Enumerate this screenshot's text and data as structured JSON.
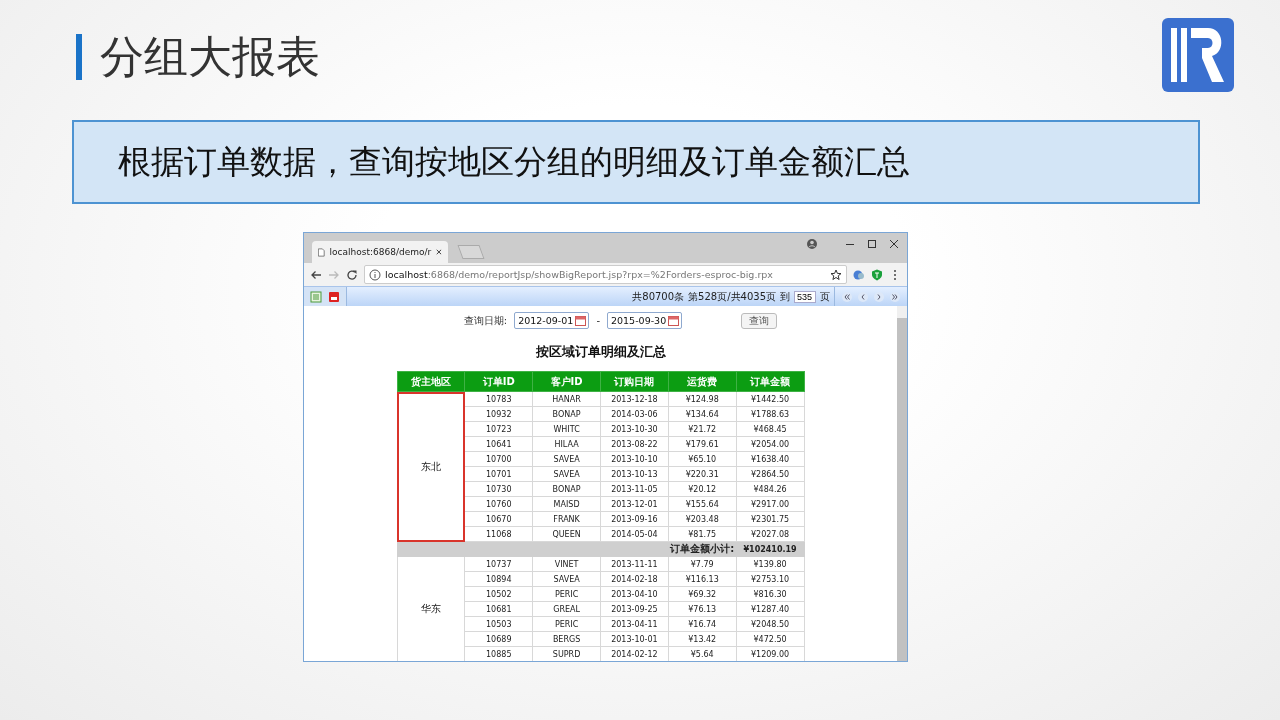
{
  "slide": {
    "title": "分组大报表",
    "banner": "根据订单数据，查询按地区分组的明细及订单金额汇总"
  },
  "browser": {
    "tab_title": "localhost:6868/demo/r",
    "url_host": "localhost",
    "url_path": ":6868/demo/reportJsp/showBigReport.jsp?rpx=%2Forders-esproc-big.rpx"
  },
  "report_toolbar": {
    "total": "共80700条",
    "page": "第528页/共4035页",
    "goto_label": "到",
    "goto_value": "535",
    "page_unit": "页"
  },
  "query": {
    "label": "查询日期:",
    "start_date": "2012-09-01",
    "separator": "-",
    "end_date": "2015-09-30",
    "button": "查询"
  },
  "report": {
    "title": "按区域订单明细及汇总",
    "columns": [
      "货主地区",
      "订单ID",
      "客户ID",
      "订购日期",
      "运货费",
      "订单金额"
    ],
    "groups": [
      {
        "region": "东北",
        "highlighted": true,
        "rows": [
          [
            "10783",
            "HANAR",
            "2013-12-18",
            "¥124.98",
            "¥1442.50"
          ],
          [
            "10932",
            "BONAP",
            "2014-03-06",
            "¥134.64",
            "¥1788.63"
          ],
          [
            "10723",
            "WHITC",
            "2013-10-30",
            "¥21.72",
            "¥468.45"
          ],
          [
            "10641",
            "HILAA",
            "2013-08-22",
            "¥179.61",
            "¥2054.00"
          ],
          [
            "10700",
            "SAVEA",
            "2013-10-10",
            "¥65.10",
            "¥1638.40"
          ],
          [
            "10701",
            "SAVEA",
            "2013-10-13",
            "¥220.31",
            "¥2864.50"
          ],
          [
            "10730",
            "BONAP",
            "2013-11-05",
            "¥20.12",
            "¥484.26"
          ],
          [
            "10760",
            "MAISD",
            "2013-12-01",
            "¥155.64",
            "¥2917.00"
          ],
          [
            "10670",
            "FRANK",
            "2013-09-16",
            "¥203.48",
            "¥2301.75"
          ],
          [
            "11068",
            "QUEEN",
            "2014-05-04",
            "¥81.75",
            "¥2027.08"
          ]
        ],
        "subtotal": {
          "label": "订单金额小计:",
          "value": "¥102410.19"
        }
      },
      {
        "region": "华东",
        "highlighted": false,
        "rows": [
          [
            "10737",
            "VINET",
            "2013-11-11",
            "¥7.79",
            "¥139.80"
          ],
          [
            "10894",
            "SAVEA",
            "2014-02-18",
            "¥116.13",
            "¥2753.10"
          ],
          [
            "10502",
            "PERIC",
            "2013-04-10",
            "¥69.32",
            "¥816.30"
          ],
          [
            "10681",
            "GREAL",
            "2013-09-25",
            "¥76.13",
            "¥1287.40"
          ],
          [
            "10503",
            "PERIC",
            "2013-04-11",
            "¥16.74",
            "¥2048.50"
          ],
          [
            "10689",
            "BERGS",
            "2013-10-01",
            "¥13.42",
            "¥472.50"
          ],
          [
            "10885",
            "SUPRD",
            "2014-02-12",
            "¥5.64",
            "¥1209.00"
          ]
        ]
      }
    ]
  }
}
